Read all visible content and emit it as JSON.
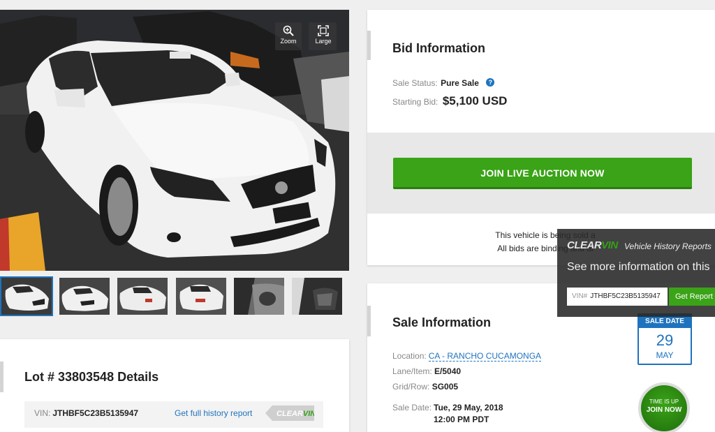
{
  "photo_tools": {
    "zoom_label": "Zoom",
    "large_label": "Large"
  },
  "lot": {
    "title": "Lot # 33803548 Details",
    "vin_label": "VIN:",
    "vin": "JTHBF5C23B5135947",
    "history_link": "Get full history report",
    "clearvin_tag": "CLEARVIN"
  },
  "bid": {
    "title": "Bid Information",
    "sale_status_label": "Sale Status:",
    "sale_status": "Pure Sale",
    "starting_bid_label": "Starting Bid:",
    "starting_bid": "$5,100 USD",
    "join_button": "JOIN LIVE AUCTION NOW",
    "disclaimer_line1": "This vehicle is being sold a",
    "disclaimer_line2": "All bids are binding and al"
  },
  "sale": {
    "title": "Sale Information",
    "location_label": "Location:",
    "location": "CA - RANCHO CUCAMONGA",
    "lane_label": "Lane/Item:",
    "lane": "E/5040",
    "grid_label": "Grid/Row:",
    "grid": "SG005",
    "sale_date_label": "Sale Date:",
    "sale_date": "Tue, 29 May, 2018",
    "sale_time": "12:00 PM PDT",
    "badge_header": "SALE DATE",
    "badge_day": "29",
    "badge_month": "MAY",
    "time_up_line1": "TIME IS UP",
    "time_up_line2": "JOIN NOW"
  },
  "clearvin": {
    "logo_clear": "CLEAR",
    "logo_vin": "VIN",
    "tagline": "Vehicle History Reports",
    "more_info": "See more information on this",
    "vin_prefix": "VIN#",
    "vin_value": "JTHBF5C23B5135947",
    "report_button": "Get Report N"
  },
  "colors": {
    "accent_blue": "#1e73be",
    "action_green": "#3aa317",
    "page_bg": "#efefef"
  }
}
